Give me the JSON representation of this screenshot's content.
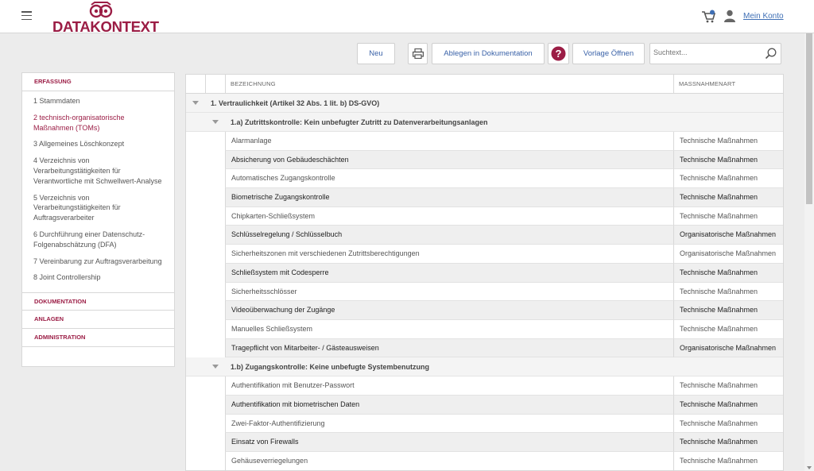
{
  "header": {
    "logo_text": "DATAKONTEXT",
    "account_label": "Mein Konto",
    "brand_color": "#9b1d45",
    "link_color": "#3f6fb5"
  },
  "toolbar": {
    "new_label": "Neu",
    "archive_label": "Ablegen in Dokumentation",
    "template_label": "Vorlage Öffnen",
    "search_placeholder": "Suchtext..."
  },
  "sidebar": {
    "sections": [
      {
        "label": "ERFASSUNG"
      },
      {
        "label": "DOKUMENTATION"
      },
      {
        "label": "ANLAGEN"
      },
      {
        "label": "ADMINISTRATION"
      }
    ],
    "items": [
      {
        "label": "1 Stammdaten",
        "active": false
      },
      {
        "label": "2 technisch-organisatorische Maßnahmen (TOMs)",
        "active": true
      },
      {
        "label": "3 Allgemeines Löschkonzept",
        "active": false
      },
      {
        "label": "4 Verzeichnis von Verarbeitungstätigkeiten für Verantwortliche mit Schwellwert-Analyse",
        "active": false
      },
      {
        "label": "5 Verzeichnis von Verarbeitungstätigkeiten für Auftragsverarbeiter",
        "active": false
      },
      {
        "label": "6 Durchführung einer Datenschutz-Folgenabschätzung (DFA)",
        "active": false
      },
      {
        "label": "7 Vereinbarung zur Auftragsverarbeitung",
        "active": false
      },
      {
        "label": "8 Joint Controllership",
        "active": false
      }
    ]
  },
  "table": {
    "columns": {
      "name": "BEZEICHNUNG",
      "type": "MASSNAHMENART"
    },
    "group_label": "1. Vertraulichkeit (Artikel 32 Abs. 1 lit. b) DS-GVO)",
    "subgroups": [
      {
        "label": "1.a) Zutrittskontrolle: Kein unbefugter Zutritt zu Datenverarbeitungsanlagen",
        "rows": [
          {
            "name": "Alarmanlage",
            "type": "Technische Maßnahmen"
          },
          {
            "name": "Absicherung von Gebäudeschächten",
            "type": "Technische Maßnahmen"
          },
          {
            "name": "Automatisches Zugangskontrolle",
            "type": "Technische Maßnahmen"
          },
          {
            "name": "Biometrische Zugangskontrolle",
            "type": "Technische Maßnahmen"
          },
          {
            "name": "Chipkarten-Schließsystem",
            "type": "Technische Maßnahmen"
          },
          {
            "name": "Schlüsselregelung / Schlüsselbuch",
            "type": "Organisatorische Maßnahmen"
          },
          {
            "name": "Sicherheitszonen mit verschiedenen Zutrittsberechtigungen",
            "type": "Organisatorische Maßnahmen"
          },
          {
            "name": "Schließsystem mit Codesperre",
            "type": "Technische Maßnahmen"
          },
          {
            "name": "Sicherheitsschlösser",
            "type": "Technische Maßnahmen"
          },
          {
            "name": "Videoüberwachung der Zugänge",
            "type": "Technische Maßnahmen"
          },
          {
            "name": "Manuelles Schließsystem",
            "type": "Technische Maßnahmen"
          },
          {
            "name": "Tragepflicht von Mitarbeiter- / Gästeausweisen",
            "type": "Organisatorische Maßnahmen"
          }
        ]
      },
      {
        "label": "1.b) Zugangskontrolle: Keine unbefugte Systembenutzung",
        "rows": [
          {
            "name": "Authentifikation mit Benutzer-Passwort",
            "type": "Technische Maßnahmen"
          },
          {
            "name": "Authentifikation mit biometrischen Daten",
            "type": "Technische Maßnahmen"
          },
          {
            "name": "Zwei-Faktor-Authentifizierung",
            "type": "Technische Maßnahmen"
          },
          {
            "name": "Einsatz von Firewalls",
            "type": "Technische Maßnahmen"
          },
          {
            "name": "Gehäuseverriegelungen",
            "type": "Technische Maßnahmen"
          }
        ]
      }
    ]
  }
}
